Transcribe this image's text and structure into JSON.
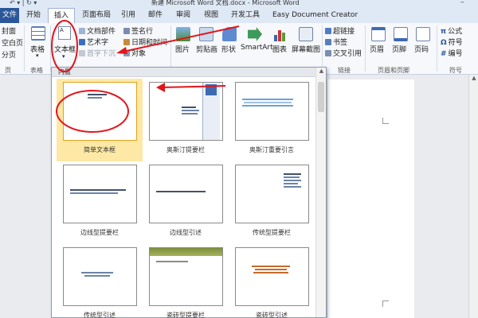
{
  "window": {
    "title": "新建 Microsoft Word 文档.docx - Microsoft Word",
    "qat_icons": "↶ ▾ | ↻ ▾",
    "minimize": "–"
  },
  "tabs": [
    {
      "label": "文件",
      "active": false
    },
    {
      "label": "开始",
      "active": false
    },
    {
      "label": "插入",
      "active": true
    },
    {
      "label": "页面布局",
      "active": false
    },
    {
      "label": "引用",
      "active": false
    },
    {
      "label": "邮件",
      "active": false
    },
    {
      "label": "审阅",
      "active": false
    },
    {
      "label": "视图",
      "active": false
    },
    {
      "label": "开发工具",
      "active": false
    },
    {
      "label": "Easy Document Creator",
      "active": false
    }
  ],
  "ribbon": {
    "pages": {
      "items": [
        "封面",
        "空白页",
        "分页"
      ],
      "group_label": "页"
    },
    "table": {
      "label": "表格",
      "arrow": "▾",
      "group_label": "表格"
    },
    "text": {
      "textbox_label": "文本框",
      "textbox_arrow": "▾",
      "textbox_icon_text": "A",
      "items": [
        "文档部件",
        "艺术字",
        "首字下沉"
      ],
      "items2": [
        "签名行",
        "日期和时间",
        "对象"
      ]
    },
    "illustrations": {
      "items": [
        "图片",
        "剪贴画",
        "形状",
        "SmartArt",
        "图表",
        "屏幕截图"
      ]
    },
    "links": {
      "items": [
        "超链接",
        "书签",
        "交叉引用"
      ],
      "group_label": "链接"
    },
    "header_footer": {
      "items": [
        "页眉",
        "页脚",
        "页码"
      ],
      "group_label": "页眉和页脚"
    },
    "symbols": {
      "items": [
        "公式",
        "符号",
        "编号"
      ],
      "icons": [
        "π",
        "Ω",
        "#"
      ],
      "group_label": "符号"
    }
  },
  "gallery": {
    "header": "内置",
    "items": [
      {
        "label": "简单文本框",
        "selected": true,
        "style": "simple"
      },
      {
        "label": "奥斯汀提要栏",
        "selected": false,
        "style": "austin-sidebar"
      },
      {
        "label": "奥斯汀重要引言",
        "selected": false,
        "style": "austin-quote"
      },
      {
        "label": "边线型提要栏",
        "selected": false,
        "style": "border-sidebar"
      },
      {
        "label": "边线型引述",
        "selected": false,
        "style": "border-quote"
      },
      {
        "label": "传统型提要栏",
        "selected": false,
        "style": "traditional-sidebar"
      },
      {
        "label": "传统型引述",
        "selected": false,
        "style": "traditional-quote"
      },
      {
        "label": "瓷砖型提要栏",
        "selected": false,
        "style": "tile-sidebar"
      },
      {
        "label": "瓷砖型引述",
        "selected": false,
        "style": "tile-quote"
      }
    ]
  },
  "colors": {
    "file_tab": "#2b579a",
    "selected_item": "#fde8a5",
    "annotation_red": "#e3141c"
  }
}
